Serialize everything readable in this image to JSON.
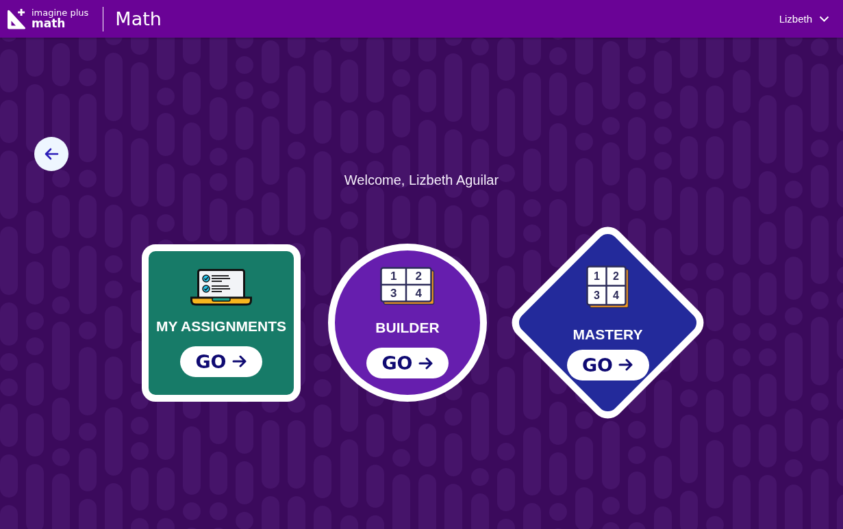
{
  "header": {
    "logo_text": [
      "imagine plus",
      "math"
    ],
    "title": "Math",
    "user_menu": {
      "label": "Lizbeth"
    }
  },
  "welcome": "Welcome, Lizbeth Aguilar",
  "cards": [
    {
      "kind": "square",
      "title": "MY ASSIGNMENTS",
      "color": "#177b68",
      "button": "GO"
    },
    {
      "kind": "circle",
      "title": "BUILDER",
      "color": "#661eae",
      "tile_digits": [
        "1",
        "2",
        "3",
        "4"
      ],
      "button": "GO"
    },
    {
      "kind": "diamond",
      "title": "MASTERY",
      "color": "#232a9b",
      "tile_digits": [
        "1",
        "2",
        "3",
        "4"
      ],
      "button": "GO"
    }
  ]
}
